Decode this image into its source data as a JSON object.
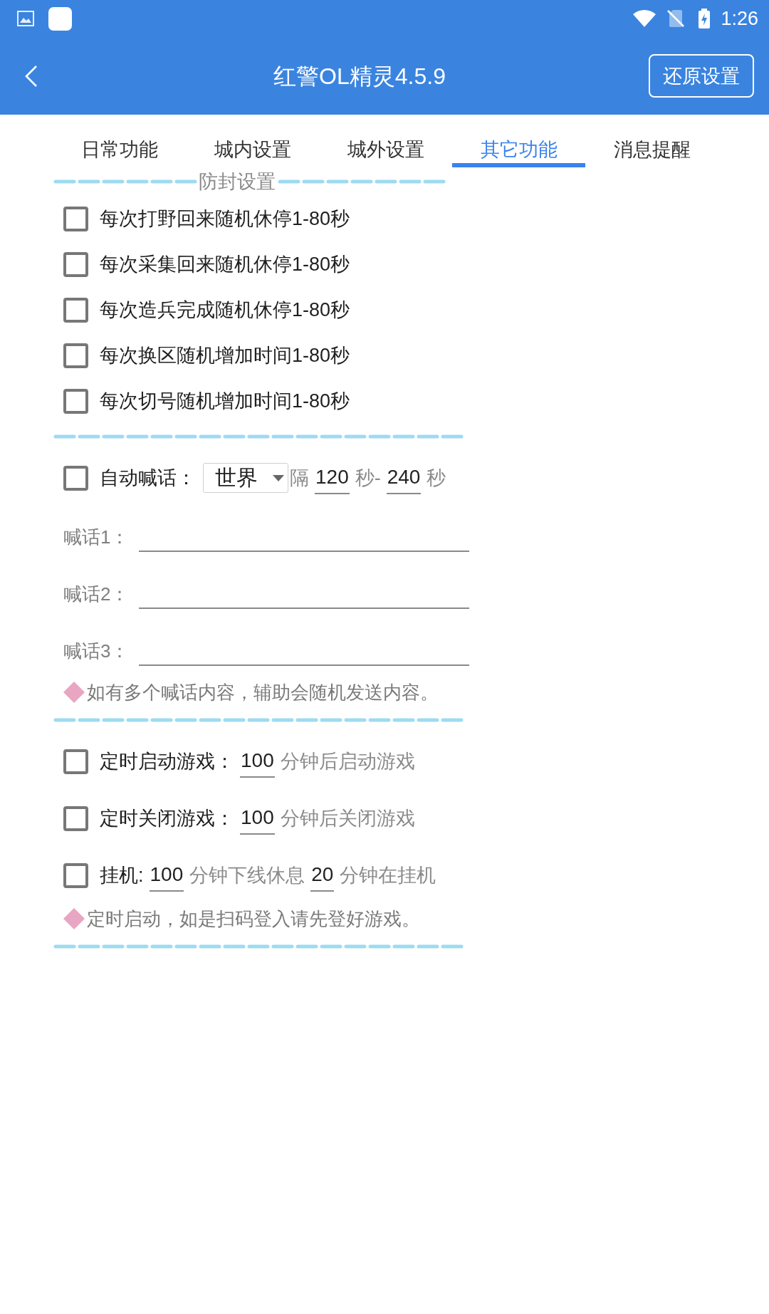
{
  "status_bar": {
    "time": "1:26"
  },
  "app_bar": {
    "title": "红警OL精灵4.5.9",
    "button": "还原设置"
  },
  "tabs": [
    {
      "label": "日常功能",
      "selected": false
    },
    {
      "label": "城内设置",
      "selected": false
    },
    {
      "label": "城外设置",
      "selected": false
    },
    {
      "label": "其它功能",
      "selected": true
    },
    {
      "label": "消息提醒",
      "selected": false
    }
  ],
  "sections": [
    {
      "title": "防封设置",
      "rows": [
        {
          "kind": "checkbox",
          "checked": false,
          "parts": [
            {
              "kind": "label",
              "text": "每次打野回来随机休停1-80秒"
            }
          ]
        },
        {
          "kind": "checkbox",
          "checked": false,
          "parts": [
            {
              "kind": "label",
              "text": "每次采集回来随机休停1-80秒"
            }
          ]
        },
        {
          "kind": "checkbox",
          "checked": false,
          "parts": [
            {
              "kind": "label",
              "text": "每次造兵完成随机休停1-80秒"
            }
          ]
        },
        {
          "kind": "checkbox",
          "checked": false,
          "parts": [
            {
              "kind": "label",
              "text": "每次换区随机增加时间1-80秒"
            }
          ]
        },
        {
          "kind": "checkbox",
          "checked": false,
          "parts": [
            {
              "kind": "label",
              "text": "每次切号随机增加时间1-80秒"
            }
          ]
        }
      ]
    },
    {
      "rows": [
        {
          "kind": "checkbox",
          "checked": false,
          "parts": [
            {
              "kind": "label",
              "text": "自动喊话："
            },
            {
              "kind": "select",
              "value": "世界"
            },
            {
              "kind": "unit",
              "text": "隔"
            },
            {
              "kind": "input",
              "value": "120"
            },
            {
              "kind": "unit",
              "text": "秒-"
            },
            {
              "kind": "input",
              "value": "240"
            },
            {
              "kind": "unit",
              "text": "秒"
            }
          ]
        },
        {
          "kind": "field",
          "label": "喊话1："
        },
        {
          "kind": "field",
          "label": "喊话2："
        },
        {
          "kind": "field",
          "label": "喊话3："
        },
        {
          "kind": "tip",
          "text": "如有多个喊话内容，辅助会随机发送内容。"
        }
      ]
    },
    {
      "rows": [
        {
          "kind": "checkbox",
          "checked": false,
          "parts": [
            {
              "kind": "label",
              "text": "定时启动游戏："
            },
            {
              "kind": "input",
              "value": "100"
            },
            {
              "kind": "unit",
              "text": "分钟后启动游戏"
            }
          ]
        },
        {
          "kind": "checkbox",
          "checked": false,
          "parts": [
            {
              "kind": "label",
              "text": "定时关闭游戏："
            },
            {
              "kind": "input",
              "value": "100"
            },
            {
              "kind": "unit",
              "text": "分钟后关闭游戏"
            }
          ]
        },
        {
          "kind": "checkbox",
          "checked": false,
          "parts": [
            {
              "kind": "label",
              "text": "挂机:"
            },
            {
              "kind": "input",
              "value": "100"
            },
            {
              "kind": "unit",
              "text": "分钟下线休息"
            },
            {
              "kind": "input",
              "value": "20"
            },
            {
              "kind": "unit",
              "text": "分钟在挂机"
            }
          ]
        },
        {
          "kind": "tip",
          "text": "定时启动，如是扫码登入请先登好游戏。"
        }
      ]
    }
  ]
}
